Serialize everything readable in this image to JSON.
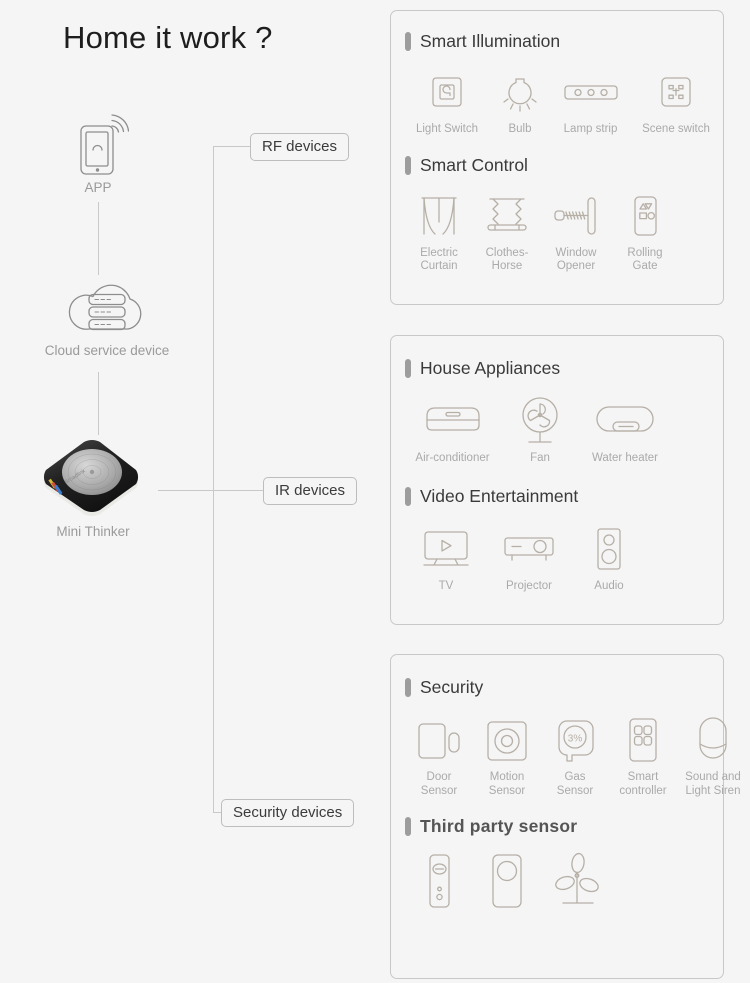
{
  "page": {
    "title": "Home it work ?"
  },
  "diagram": {
    "nodes": [
      {
        "id": "app",
        "label": "APP",
        "icon": "smartphone-wifi-icon"
      },
      {
        "id": "cloud",
        "label": "Cloud service device",
        "icon": "cloud-server-icon"
      },
      {
        "id": "hub",
        "label": "Mini Thinker",
        "icon": "mini-thinker-hub-icon"
      }
    ],
    "bus_labels": [
      {
        "id": "rf",
        "label": "RF devices"
      },
      {
        "id": "ir",
        "label": "IR devices"
      },
      {
        "id": "security",
        "label": "Security devices"
      }
    ]
  },
  "panels": [
    {
      "id": "panel-rf",
      "sections": [
        {
          "title": "Smart Illumination",
          "bold": false,
          "items": [
            {
              "label": "Light Switch",
              "icon": "light-switch-icon"
            },
            {
              "label": "Bulb",
              "icon": "bulb-icon"
            },
            {
              "label": "Lamp strip",
              "icon": "lamp-strip-icon"
            },
            {
              "label": "Scene switch",
              "icon": "scene-switch-icon"
            }
          ]
        },
        {
          "title": "Smart Control",
          "bold": false,
          "items": [
            {
              "label": "Electric\nCurtain",
              "icon": "electric-curtain-icon"
            },
            {
              "label": "Clothes-\nHorse",
              "icon": "clothes-horse-icon"
            },
            {
              "label": "Window\nOpener",
              "icon": "window-opener-icon"
            },
            {
              "label": "Rolling\nGate",
              "icon": "rolling-gate-icon"
            }
          ]
        }
      ]
    },
    {
      "id": "panel-ir",
      "sections": [
        {
          "title": "House Appliances",
          "bold": false,
          "items": [
            {
              "label": "Air-conditioner",
              "icon": "air-conditioner-icon"
            },
            {
              "label": "Fan",
              "icon": "fan-icon"
            },
            {
              "label": "Water heater",
              "icon": "water-heater-icon"
            }
          ]
        },
        {
          "title": "Video Entertainment",
          "bold": false,
          "items": [
            {
              "label": "TV",
              "icon": "tv-icon"
            },
            {
              "label": "Projector",
              "icon": "projector-icon"
            },
            {
              "label": "Audio",
              "icon": "audio-speaker-icon"
            }
          ]
        }
      ]
    },
    {
      "id": "panel-security",
      "sections": [
        {
          "title": "Security",
          "bold": false,
          "items": [
            {
              "label": "Door\nSensor",
              "icon": "door-sensor-icon"
            },
            {
              "label": "Motion\nSensor",
              "icon": "motion-sensor-icon"
            },
            {
              "label": "Gas\nSensor",
              "icon": "gas-sensor-icon",
              "value": "3%"
            },
            {
              "label": "Smart\ncontroller",
              "icon": "smart-controller-icon"
            },
            {
              "label": "Sound and\nLight Siren",
              "icon": "sound-light-siren-icon"
            }
          ]
        },
        {
          "title": "Third party sensor",
          "bold": true,
          "items": [
            {
              "label": "",
              "icon": "wall-switch-sensor-icon"
            },
            {
              "label": "",
              "icon": "round-button-sensor-icon"
            },
            {
              "label": "",
              "icon": "plant-monitor-icon"
            }
          ]
        }
      ]
    }
  ],
  "colors": {
    "background": "#f5f5f5",
    "panel_border": "#c8c8c8",
    "connector": "#c9c9c9",
    "icon_stroke": "#b6afa6",
    "caption": "#aaaaaa",
    "heading": "#3a3a3a",
    "section_bar": "#9d9d9d"
  }
}
